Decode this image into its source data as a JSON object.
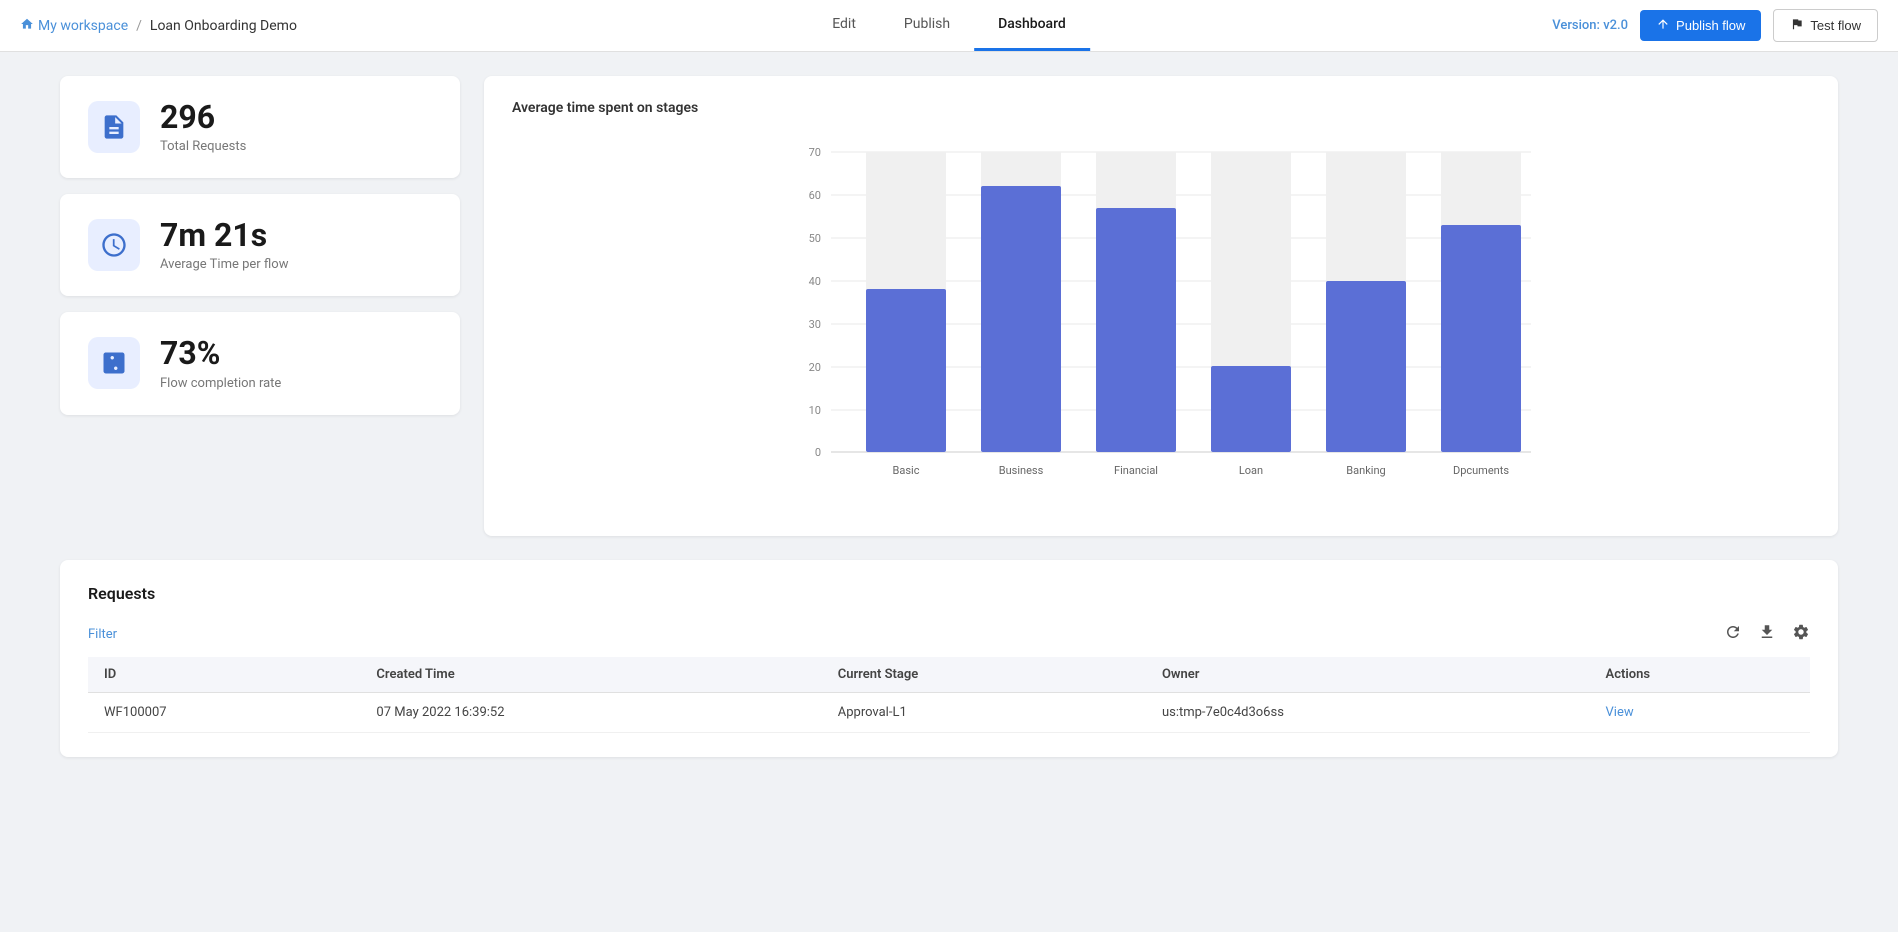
{
  "header": {
    "workspace_label": "My workspace",
    "breadcrumb_sep": "/",
    "project_name": "Loan Onboarding Demo",
    "nav_tabs": [
      {
        "id": "edit",
        "label": "Edit"
      },
      {
        "id": "publish",
        "label": "Publish"
      },
      {
        "id": "dashboard",
        "label": "Dashboard",
        "active": true
      }
    ],
    "version_label": "Version: v2.0",
    "publish_flow_btn": "Publish flow",
    "test_flow_btn": "Test flow"
  },
  "stats": [
    {
      "id": "total-requests",
      "value": "296",
      "label": "Total Requests",
      "icon": "file-icon"
    },
    {
      "id": "avg-time",
      "value": "7m 21s",
      "label": "Average Time per flow",
      "icon": "clock-icon"
    },
    {
      "id": "completion-rate",
      "value": "73%",
      "label": "Flow completion rate",
      "icon": "percent-icon"
    }
  ],
  "chart": {
    "title": "Average time spent on stages",
    "y_max": 70,
    "y_labels": [
      0,
      10,
      20,
      30,
      40,
      50,
      60,
      70
    ],
    "bars": [
      {
        "label": "Basic",
        "value": 38
      },
      {
        "label": "Business",
        "value": 62
      },
      {
        "label": "Financial",
        "value": 57
      },
      {
        "label": "Loan",
        "value": 20
      },
      {
        "label": "Banking",
        "value": 40
      },
      {
        "label": "Dpcuments",
        "value": 53
      }
    ],
    "bar_color": "#5b6fd6"
  },
  "requests": {
    "title": "Requests",
    "filter_label": "Filter",
    "columns": [
      "ID",
      "Created Time",
      "Current Stage",
      "Owner",
      "Actions"
    ],
    "rows": [
      {
        "id": "WF100007",
        "created_time": "07 May 2022 16:39:52",
        "current_stage": "Approval-L1",
        "owner": "us:tmp-7e0c4d3o6ss",
        "action": "View"
      }
    ]
  },
  "icons": {
    "home": "🏠",
    "publish_arrow": "↗",
    "test_flag": "⚑",
    "refresh": "↺",
    "download": "⬇",
    "settings": "⚙"
  }
}
